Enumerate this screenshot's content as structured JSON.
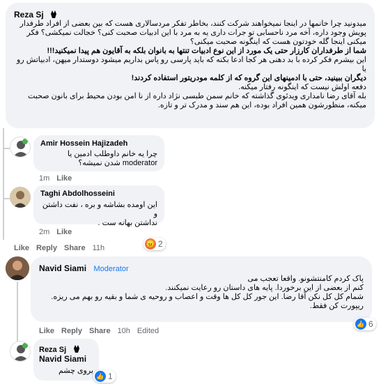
{
  "c1": {
    "author": "Reza Sj",
    "lines": [
      "میدونید چرا خانمها در اینجا نمیخواهند شرکت کنند، بخاطر تفکر مردسالاری هست که بین بعضی از افراد طرفدار",
      "پویش وجود داره، آخه مرد ناحسابی تو جرات داری یه به مرد با این ادبیات صحبت کنی؟ خجالت نمیکشی؟ فکر",
      "میکنی اینجا گله خودتون هست که اینگونه صحبت میکنی؟",
      "شما از طرفداران کارزار حتی یک مورد از این نوع ادبیات تنتها به بانوان بلکه به آقایون هم پیدا نمیکنید!!!",
      "این بیشرم فکر کرده با بد دهنی هر کجا ادعا بکنه که باید پارسی رو پاس بداریم میشود دوستدار میهن، ادبیاتش رو یا",
      "دیگران ببینید، حتی با ادمینهای این گروه که از کلمه مودریتور استفاده کردند!",
      "دفعه اولش نیست که اینگونه رفتار میکنه.",
      "بله آقای رضا نامداری ویدئوی گذاشته که خانم سمن طبسی نژاد داره از نا امن بودن محیط برای بانون صحبت",
      "میکنه، منظورشون همین افراد بوده، این هم سند و مدرک تر و تازه."
    ],
    "like": "Like",
    "reply": "Reply",
    "share": "Share",
    "time": "11h",
    "reaction_count": "2"
  },
  "r1": {
    "author": "Amir Hossein Hajizadeh",
    "lines": [
      "چرا یه خانم داوطلب ادمین یا",
      "moderator شدن نمیشه؟"
    ],
    "time": "1m",
    "like": "Like"
  },
  "r2": {
    "author": "Taghi Abdolhosseini",
    "lines": [
      "این اومده بشاشه و بره ، نفت داشتن و",
      "نداشتن بهانه ست ."
    ],
    "time": "2m",
    "like": "Like"
  },
  "c2": {
    "author": "Navid Siami",
    "badge": "Moderator",
    "lines": [
      "پاک کردم کامنتشونو. واقعا تعجب می",
      "کنم از بعضی از این برخوردا. پایه های داستان رو رعایت نمیکنند.",
      "شمام کل کل نکن آقا رضا. این جور کل کل ها وقت و اعصاب و روحیه ی شما و بقیه رو بهم می ریزه.",
      "ریپورت کن فقط."
    ],
    "like": "Like",
    "reply": "Reply",
    "share": "Share",
    "time": "10h",
    "edited": "Edited",
    "reaction_count": "6"
  },
  "c3": {
    "author": "Reza Sj",
    "tag": "Navid Siami",
    "text": "بروی چشم",
    "reaction_count": "1"
  },
  "colors": {
    "bubble": "#f0f2f5",
    "link": "#1877f2",
    "meta": "#65676b"
  }
}
